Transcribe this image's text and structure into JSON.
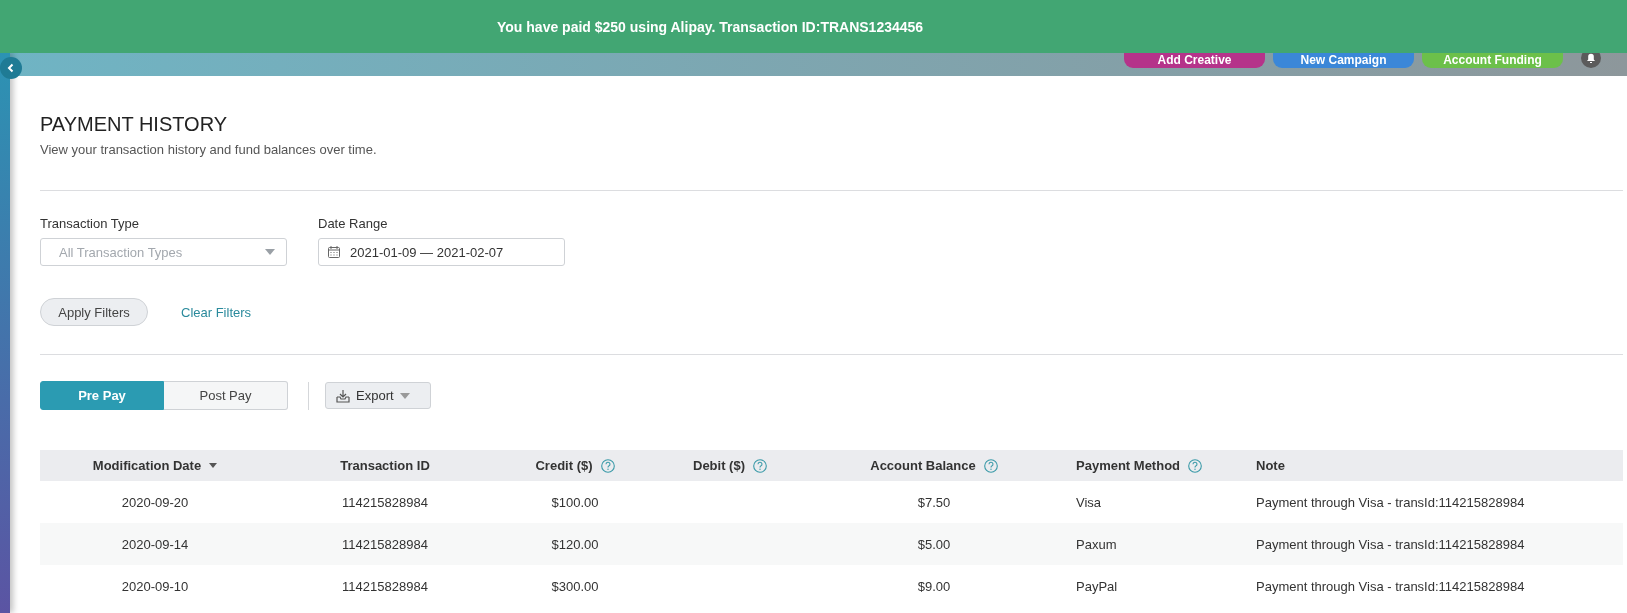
{
  "banner": {
    "message": "You have paid $250 using Alipay. Transaction ID:TRANS1234456"
  },
  "header_buttons": [
    {
      "label": "Add Creative",
      "color": "#b5338a"
    },
    {
      "label": "New Campaign",
      "color": "#3b87d8"
    },
    {
      "label": "Account Funding",
      "color": "#6cc04a"
    }
  ],
  "page": {
    "title": "PAYMENT HISTORY",
    "subtitle": "View your transaction history and fund balances over time."
  },
  "filters": {
    "transaction_type": {
      "label": "Transaction Type",
      "placeholder": "All Transaction Types"
    },
    "date_range": {
      "label": "Date Range",
      "value": "2021-01-09 — 2021-02-07"
    },
    "apply": "Apply Filters",
    "clear": "Clear Filters"
  },
  "tabs": [
    {
      "label": "Pre Pay",
      "selected": true
    },
    {
      "label": "Post Pay",
      "selected": false
    }
  ],
  "export": {
    "label": "Export"
  },
  "table": {
    "columns": [
      {
        "label": "Modification Date",
        "kind": "sorted"
      },
      {
        "label": "Transaction ID",
        "kind": "plain"
      },
      {
        "label": "Credit ($)",
        "kind": "help"
      },
      {
        "label": "Debit ($)",
        "kind": "help"
      },
      {
        "label": "Account Balance",
        "kind": "help"
      },
      {
        "label": "Payment Method",
        "kind": "help"
      },
      {
        "label": "Note",
        "kind": "plain"
      }
    ],
    "rows": [
      [
        "2020-09-20",
        "114215828984",
        "$100.00",
        "",
        "$7.50",
        "Visa",
        "Payment through Visa - transId:114215828984"
      ],
      [
        "2020-09-14",
        "114215828984",
        "$120.00",
        "",
        "$5.00",
        "Paxum",
        "Payment through Visa - transId:114215828984"
      ],
      [
        "2020-09-10",
        "114215828984",
        "$300.00",
        "",
        "$9.00",
        "PayPal",
        "Payment through Visa - transId:114215828984"
      ]
    ]
  }
}
